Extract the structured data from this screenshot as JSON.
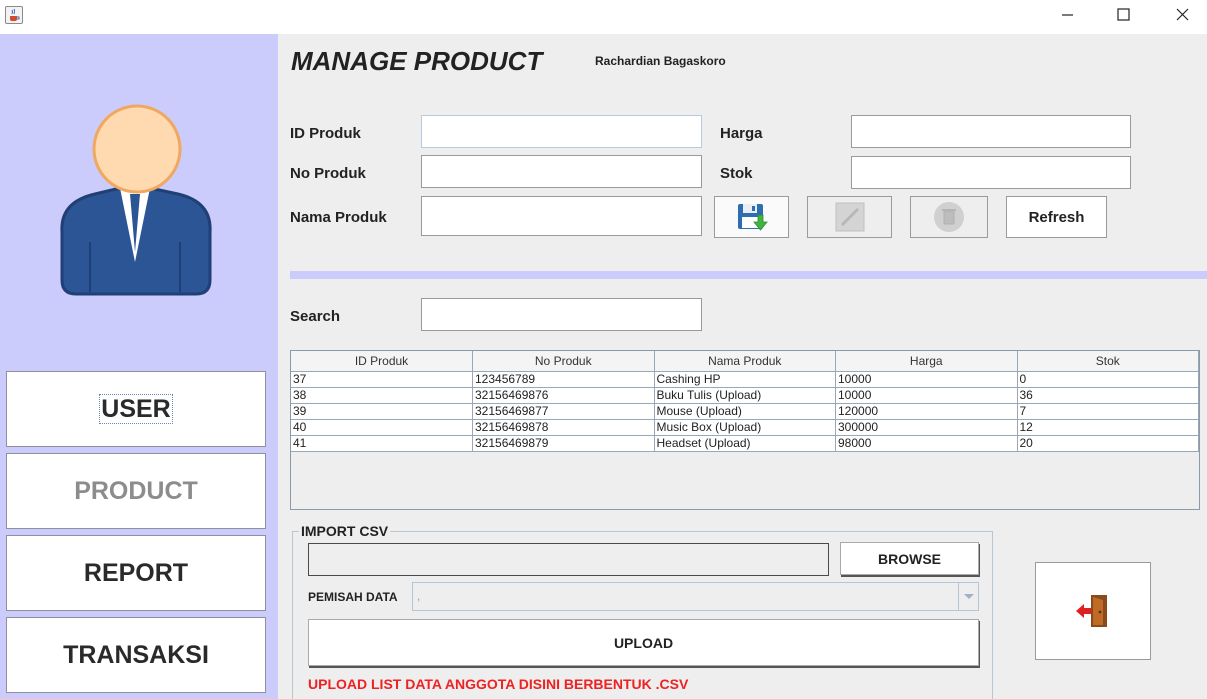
{
  "window": {
    "icon": "java-cup-icon",
    "controls": [
      "minimize-icon",
      "maximize-icon",
      "close-icon"
    ]
  },
  "sidebar": {
    "avatar": "user-avatar-icon",
    "nav": [
      {
        "label": "USER",
        "state": "focused"
      },
      {
        "label": "PRODUCT",
        "state": "disabled"
      },
      {
        "label": "REPORT",
        "state": "normal"
      },
      {
        "label": "TRANSAKSI",
        "state": "normal"
      }
    ]
  },
  "header": {
    "title": "MANAGE PRODUCT",
    "user": "Rachardian Bagaskoro"
  },
  "form": {
    "id_label": "ID Produk",
    "id_value": "",
    "no_label": "No Produk",
    "no_value": "",
    "nama_label": "Nama Produk",
    "nama_value": "",
    "harga_label": "Harga",
    "harga_value": "",
    "stok_label": "Stok",
    "stok_value": ""
  },
  "toolbar": {
    "save_icon": "save-floppy-icon",
    "edit_icon": "edit-icon",
    "delete_icon": "trash-icon",
    "refresh_label": "Refresh"
  },
  "search": {
    "label": "Search",
    "value": ""
  },
  "table": {
    "headers": [
      "ID Produk",
      "No Produk",
      "Nama Produk",
      "Harga",
      "Stok"
    ],
    "rows": [
      [
        "37",
        "123456789",
        "Cashing HP",
        "10000",
        "0"
      ],
      [
        "38",
        "32156469876",
        "Buku Tulis (Upload)",
        "10000",
        "36"
      ],
      [
        "39",
        "32156469877",
        "Mouse (Upload)",
        "120000",
        "7"
      ],
      [
        "40",
        "32156469878",
        "Music Box (Upload)",
        "300000",
        "12"
      ],
      [
        "41",
        "32156469879",
        "Headset (Upload)",
        "98000",
        "20"
      ]
    ]
  },
  "import_csv": {
    "title": "IMPORT CSV",
    "file_value": "",
    "browse_label": "BROWSE",
    "separator_label": "PEMISAH DATA",
    "separator_value": ",",
    "upload_label": "UPLOAD",
    "note": "UPLOAD LIST DATA ANGGOTA DISINI BERBENTUK .CSV"
  },
  "exit": {
    "icon": "exit-door-icon"
  },
  "colors": {
    "sidebar_bg": "#cbcbfc",
    "panel_bg": "#eeeeee",
    "note_red": "#ee2222"
  }
}
